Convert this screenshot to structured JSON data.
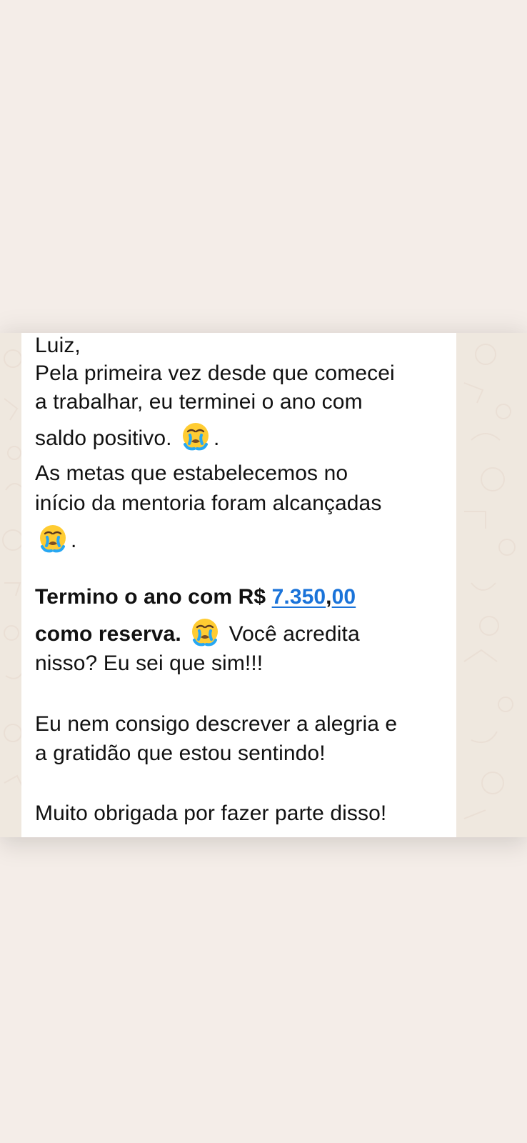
{
  "message": {
    "line1": "Luiz,",
    "line2": "Pela primeira vez desde que comecei",
    "line3": "a trabalhar, eu terminei o ano com",
    "line4_text": "saldo positivo.",
    "line4_after": ".",
    "line5": "As metas que estabelecemos no",
    "line6": "início da mentoria foram alcançadas",
    "line7_after": ".",
    "line8_prefix": "Termino o ano com R$ ",
    "line8_amount_main": "7.350",
    "line8_amount_sep": ",",
    "line8_amount_cents": "00",
    "line9_bold": "como reserva.",
    "line9_after": " Você acredita",
    "line10": "nisso? Eu sei que sim!!!",
    "line11": "Eu nem consigo descrever a alegria e",
    "line12": "a gratidão que estou sentindo!",
    "line13": "Muito obrigada por fazer parte disso!"
  },
  "icons": {
    "emoji": "loudly-crying-face-icon"
  },
  "colors": {
    "page_background": "#f4ede8",
    "chat_wallpaper": "#efe8df",
    "bubble_background": "#ffffff",
    "text": "#111111",
    "link": "#1a73d9"
  }
}
